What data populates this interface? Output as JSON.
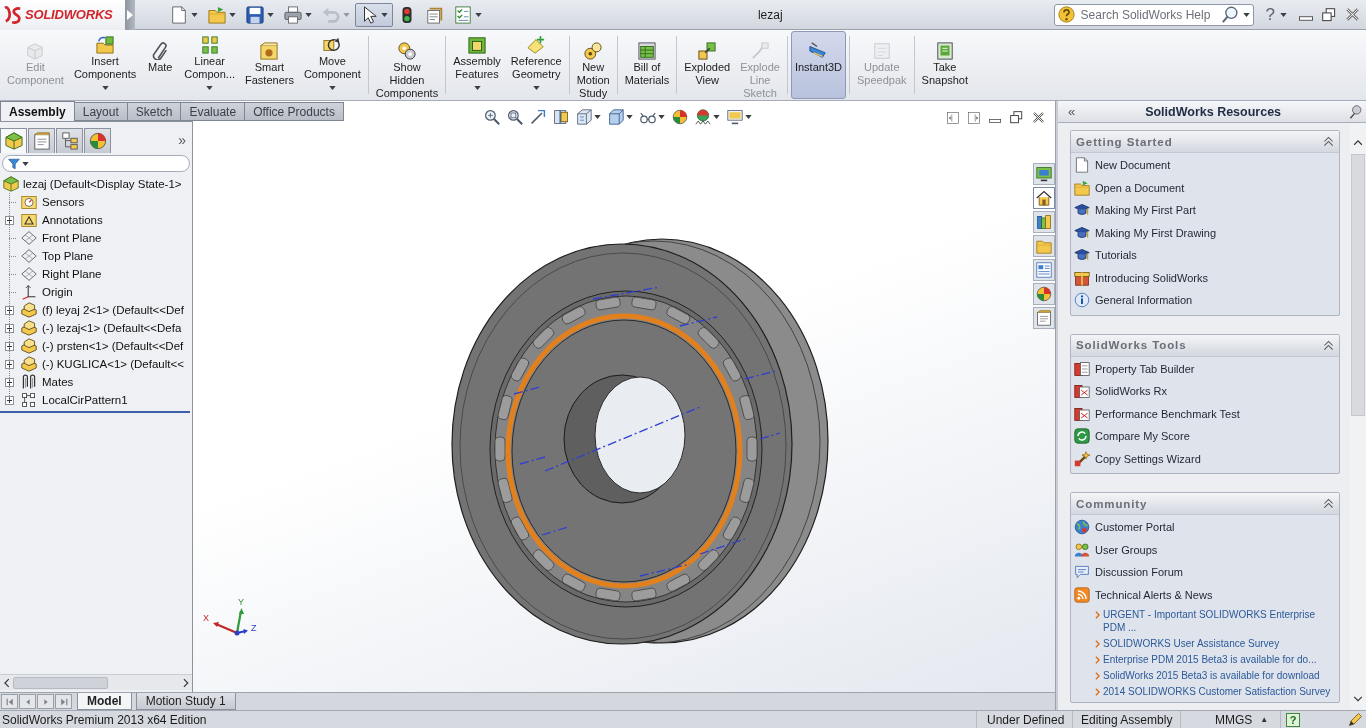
{
  "title_bar": {
    "logo_text": "SOLIDWORKS",
    "quick_access": [
      {
        "kind": "new",
        "dropdown": true,
        "disabled": false,
        "selected": false
      },
      {
        "kind": "open",
        "dropdown": true,
        "disabled": false,
        "selected": false
      },
      {
        "kind": "save",
        "dropdown": true,
        "disabled": false,
        "selected": false
      },
      {
        "kind": "print",
        "dropdown": true,
        "disabled": false,
        "selected": false
      },
      {
        "kind": "undo",
        "dropdown": true,
        "disabled": true,
        "selected": false
      },
      {
        "kind": "select",
        "dropdown": true,
        "disabled": false,
        "selected": true
      },
      {
        "kind": "rebuild",
        "dropdown": false,
        "disabled": false,
        "selected": false
      },
      {
        "kind": "file-properties",
        "dropdown": false,
        "disabled": false,
        "selected": false
      },
      {
        "kind": "options",
        "dropdown": true,
        "disabled": false,
        "selected": false
      }
    ],
    "title": "lezaj",
    "search": {
      "placeholder": "Search SolidWorks Help"
    },
    "help_glyph": "?"
  },
  "command_manager": {
    "groups": [
      {
        "buttons": [
          {
            "kind": "edit-component",
            "label": "Edit\nComponent",
            "disabled": true,
            "dropdown": false,
            "selected": false
          },
          {
            "kind": "insert-components",
            "label": "Insert\nComponents",
            "disabled": false,
            "dropdown": true,
            "selected": false
          },
          {
            "kind": "mate",
            "label": "Mate",
            "disabled": false,
            "dropdown": false,
            "selected": false
          },
          {
            "kind": "linear-pattern",
            "label": "Linear\nCompon...",
            "disabled": false,
            "dropdown": true,
            "selected": false
          },
          {
            "kind": "smart-fasteners",
            "label": "Smart\nFasteners",
            "disabled": false,
            "dropdown": false,
            "selected": false
          },
          {
            "kind": "move-component",
            "label": "Move\nComponent",
            "disabled": false,
            "dropdown": true,
            "selected": false
          }
        ]
      },
      {
        "buttons": [
          {
            "kind": "show-hidden",
            "label": "Show\nHidden\nComponents",
            "disabled": false,
            "dropdown": false,
            "selected": false
          }
        ]
      },
      {
        "buttons": [
          {
            "kind": "assembly-features",
            "label": "Assembly\nFeatures",
            "disabled": false,
            "dropdown": true,
            "selected": false
          },
          {
            "kind": "reference-geometry",
            "label": "Reference\nGeometry",
            "disabled": false,
            "dropdown": true,
            "selected": false
          }
        ]
      },
      {
        "buttons": [
          {
            "kind": "motion-study",
            "label": "New\nMotion\nStudy",
            "disabled": false,
            "dropdown": false,
            "selected": false
          }
        ]
      },
      {
        "buttons": [
          {
            "kind": "bill-of-materials",
            "label": "Bill of\nMaterials",
            "disabled": false,
            "dropdown": false,
            "selected": false
          }
        ]
      },
      {
        "buttons": [
          {
            "kind": "exploded-view",
            "label": "Exploded\nView",
            "disabled": false,
            "dropdown": false,
            "selected": false
          },
          {
            "kind": "explode-line-sketch",
            "label": "Explode\nLine\nSketch",
            "disabled": true,
            "dropdown": false,
            "selected": false
          }
        ]
      },
      {
        "buttons": [
          {
            "kind": "instant3d",
            "label": "Instant3D",
            "disabled": false,
            "dropdown": false,
            "selected": true
          }
        ]
      },
      {
        "buttons": [
          {
            "kind": "update-speedpak",
            "label": "Update\nSpeedpak",
            "disabled": true,
            "dropdown": false,
            "selected": false
          }
        ]
      },
      {
        "buttons": [
          {
            "kind": "take-snapshot",
            "label": "Take\nSnapshot",
            "disabled": false,
            "dropdown": false,
            "selected": false
          }
        ]
      }
    ]
  },
  "tabs": [
    {
      "label": "Assembly",
      "selected": true
    },
    {
      "label": "Layout",
      "selected": false
    },
    {
      "label": "Sketch",
      "selected": false
    },
    {
      "label": "Evaluate",
      "selected": false
    },
    {
      "label": "Office Products",
      "selected": false
    }
  ],
  "feature_manager": {
    "panel_tabs": [
      {
        "kind": "feature-tree",
        "selected": true
      },
      {
        "kind": "property-manager",
        "selected": false
      },
      {
        "kind": "configuration-manager",
        "selected": false
      },
      {
        "kind": "display-manager",
        "selected": false
      }
    ],
    "more_glyph": "»",
    "tree": {
      "kind": "assembly",
      "label": "lezaj (Default<Display State-1>",
      "children": [
        {
          "kind": "sensors",
          "label": "Sensors",
          "expandable": false
        },
        {
          "kind": "annotations",
          "label": "Annotations",
          "expandable": true
        },
        {
          "kind": "plane",
          "label": "Front Plane",
          "expandable": false
        },
        {
          "kind": "plane",
          "label": "Top Plane",
          "expandable": false
        },
        {
          "kind": "plane",
          "label": "Right Plane",
          "expandable": false
        },
        {
          "kind": "origin",
          "label": "Origin",
          "expandable": false
        },
        {
          "kind": "part",
          "label": "(f) leyaj 2<1> (Default<<Def",
          "expandable": true
        },
        {
          "kind": "part",
          "label": "(-) lezaj<1> (Default<<Defa",
          "expandable": true
        },
        {
          "kind": "part",
          "label": "(-) prsten<1> (Default<<Def",
          "expandable": true
        },
        {
          "kind": "part",
          "label": "(-) KUGLICA<1> (Default<<",
          "expandable": true
        },
        {
          "kind": "mates",
          "label": "Mates",
          "expandable": true
        },
        {
          "kind": "pattern",
          "label": "LocalCirPattern1",
          "expandable": true
        }
      ]
    }
  },
  "viewport": {
    "side_tabs": [
      {
        "kind": "monitor",
        "selected": false
      },
      {
        "kind": "home",
        "selected": true
      },
      {
        "kind": "library",
        "selected": false
      },
      {
        "kind": "explorer",
        "selected": false
      },
      {
        "kind": "view-palette",
        "selected": false
      },
      {
        "kind": "appearances",
        "selected": false
      },
      {
        "kind": "custom-properties",
        "selected": false
      }
    ],
    "triad": {
      "x": "X",
      "y": "Y",
      "z": "Z"
    }
  },
  "model_tabs": [
    {
      "label": "Model",
      "selected": true
    },
    {
      "label": "Motion Study 1",
      "selected": false
    }
  ],
  "task_pane": {
    "collapse_glyph": "«",
    "title": "SolidWorks Resources",
    "sections": [
      {
        "title": "Getting Started",
        "expanded": true,
        "items": [
          {
            "kind": "new-document",
            "label": "New Document"
          },
          {
            "kind": "open-document",
            "label": "Open a Document"
          },
          {
            "kind": "tutorial",
            "label": "Making My First Part"
          },
          {
            "kind": "tutorial",
            "label": "Making My First Drawing"
          },
          {
            "kind": "tutorial",
            "label": "Tutorials"
          },
          {
            "kind": "introducing",
            "label": "Introducing SolidWorks"
          },
          {
            "kind": "information",
            "label": "General Information"
          }
        ]
      },
      {
        "title": "SolidWorks Tools",
        "expanded": true,
        "items": [
          {
            "kind": "property-tab",
            "label": "Property Tab Builder"
          },
          {
            "kind": "rx",
            "label": "SolidWorks Rx"
          },
          {
            "kind": "rx",
            "label": "Performance Benchmark Test"
          },
          {
            "kind": "score",
            "label": "Compare My Score"
          },
          {
            "kind": "wizard",
            "label": "Copy Settings Wizard"
          }
        ]
      },
      {
        "title": "Community",
        "expanded": true,
        "items": [
          {
            "kind": "portal",
            "label": "Customer Portal"
          },
          {
            "kind": "groups",
            "label": "User Groups"
          },
          {
            "kind": "forum",
            "label": "Discussion Forum"
          },
          {
            "kind": "rss",
            "label": "Technical Alerts & News"
          }
        ],
        "news": [
          "URGENT - Important SOLIDWORKS Enterprise PDM ...",
          "SOLIDWORKS User Assistance Survey",
          "Enterprise PDM 2015 Beta3 is available for do...",
          "SolidWorks 2015 Beta3 is available for download",
          "2014 SOLIDWORKS Customer Satisfaction Survey"
        ]
      }
    ]
  },
  "status_bar": {
    "edition": "SolidWorks Premium 2013 x64 Edition",
    "sketch_state": "Under Defined",
    "mode": "Editing Assembly",
    "units": "MMGS",
    "units_glyph": "▲",
    "tips_glyph": "?"
  }
}
